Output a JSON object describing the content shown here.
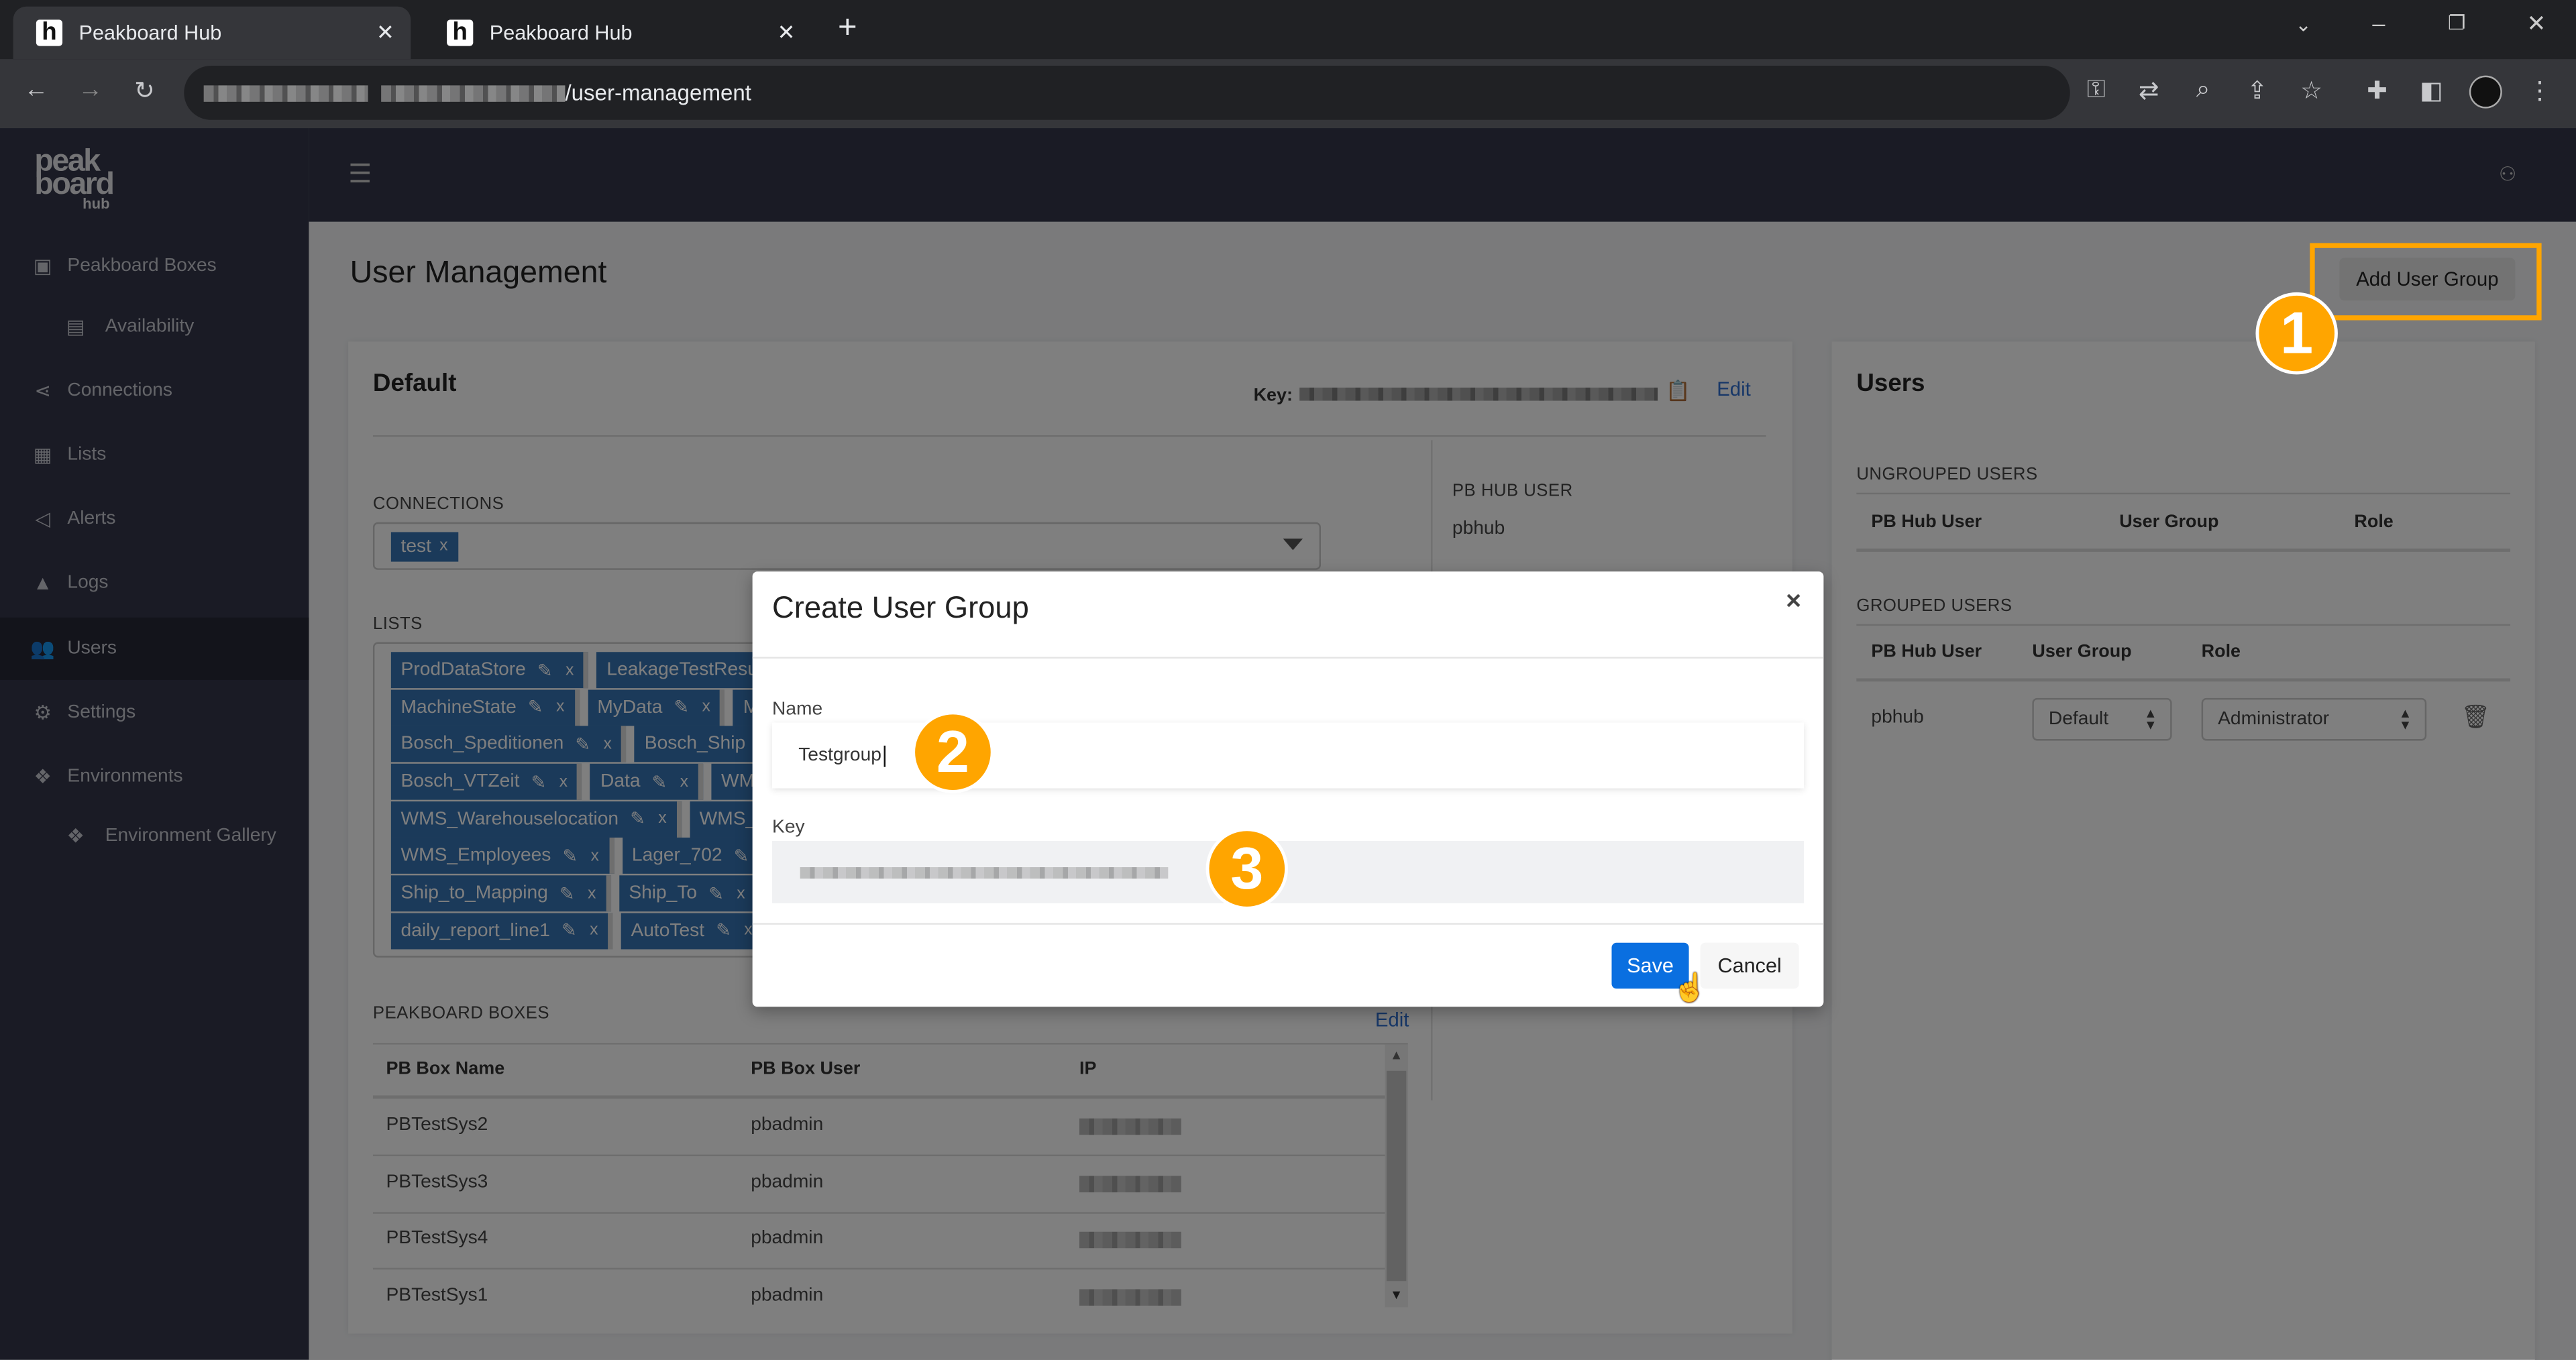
{
  "browser": {
    "tabs": [
      {
        "title": "Peakboard Hub",
        "active": true
      },
      {
        "title": "Peakboard Hub",
        "active": false
      }
    ],
    "new_tab": "+",
    "url_path": "/user-management"
  },
  "sidebar": {
    "logo": "peak board hub",
    "items": [
      {
        "label": "Peakboard Boxes",
        "icon": "peakboard-box-icon"
      },
      {
        "label": "Availability",
        "icon": "calendar-check-icon"
      },
      {
        "label": "Connections",
        "icon": "share-icon"
      },
      {
        "label": "Lists",
        "icon": "table-icon"
      },
      {
        "label": "Alerts",
        "icon": "megaphone-icon"
      },
      {
        "label": "Logs",
        "icon": "warning-icon"
      },
      {
        "label": "Users",
        "icon": "users-icon",
        "active": true
      },
      {
        "label": "Settings",
        "icon": "gear-icon"
      },
      {
        "label": "Environments",
        "icon": "environments-icon"
      },
      {
        "label": "Environment Gallery",
        "icon": "environments-icon"
      }
    ]
  },
  "page": {
    "title": "User Management",
    "add_group_button": "Add User Group"
  },
  "group_card": {
    "name": "Default",
    "key_label": "Key:",
    "edit": "Edit",
    "pb_hub_user_label": "PB HUB USER",
    "pb_hub_user": "pbhub",
    "connections_label": "CONNECTIONS",
    "connections": [
      {
        "name": "test",
        "remove": "x"
      }
    ],
    "lists_label": "LISTS",
    "list_rows": [
      [
        "ProdDataStore",
        "LeakageTestResu"
      ],
      [
        "MachineState",
        "MyData",
        "M"
      ],
      [
        "Bosch_Speditionen",
        "Bosch_Ship"
      ],
      [
        "Bosch_VTZeit",
        "Data",
        "WMS"
      ],
      [
        "WMS_Warehouselocation",
        "WMS_"
      ],
      [
        "WMS_Employees",
        "Lager_702"
      ],
      [
        "Ship_to_Mapping",
        "Ship_To"
      ],
      [
        "daily_report_line1",
        "AutoTest"
      ]
    ],
    "boxes_label": "PEAKBOARD BOXES",
    "boxes_edit": "Edit",
    "boxes_columns": [
      "PB Box Name",
      "PB Box User",
      "IP"
    ],
    "boxes": [
      {
        "name": "PBTestSys2",
        "user": "pbadmin"
      },
      {
        "name": "PBTestSys3",
        "user": "pbadmin"
      },
      {
        "name": "PBTestSys4",
        "user": "pbadmin"
      },
      {
        "name": "PBTestSys1",
        "user": "pbadmin"
      }
    ]
  },
  "users_card": {
    "title": "Users",
    "ungrouped_label": "UNGROUPED USERS",
    "ungrouped_columns": [
      "PB Hub User",
      "User Group",
      "Role"
    ],
    "grouped_label": "GROUPED USERS",
    "grouped_columns": [
      "PB Hub User",
      "User Group",
      "Role"
    ],
    "grouped": [
      {
        "user": "pbhub",
        "group": "Default",
        "role": "Administrator"
      }
    ]
  },
  "modal": {
    "title": "Create User Group",
    "close": "×",
    "name_label": "Name",
    "name_value": "Testgroup",
    "key_label": "Key",
    "save": "Save",
    "cancel": "Cancel"
  },
  "annotations": {
    "step1": "1",
    "step2": "2",
    "step3": "3",
    "color": "#ffa500"
  },
  "colors": {
    "primary": "#0a6fe0",
    "tag": "#3774b5",
    "link": "#2f6fd0"
  }
}
